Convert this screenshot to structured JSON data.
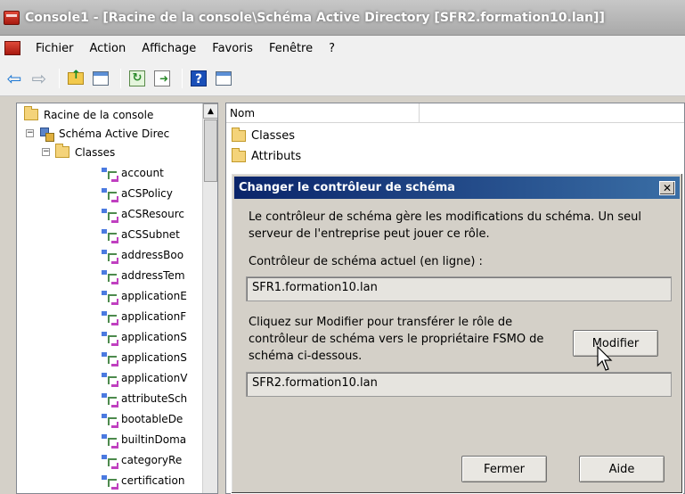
{
  "window": {
    "title": "Console1 - [Racine de la console\\Schéma Active Directory [SFR2.formation10.lan]]"
  },
  "menu": {
    "items": [
      "Fichier",
      "Action",
      "Affichage",
      "Favoris",
      "Fenêtre",
      "?"
    ]
  },
  "toolbar": {
    "icons": [
      "back-arrow-icon",
      "forward-arrow-icon",
      "up-folder-icon",
      "show-hide-tree-icon",
      "refresh-icon",
      "export-list-icon",
      "help-icon",
      "properties-icon"
    ]
  },
  "tree": {
    "root": "Racine de la console",
    "schema": "Schéma Active Direc",
    "classes_folder": "Classes",
    "classes": [
      "account",
      "aCSPolicy",
      "aCSResourc",
      "aCSSubnet",
      "addressBoo",
      "addressTem",
      "applicationE",
      "applicationF",
      "applicationS",
      "applicationS",
      "applicationV",
      "attributeSch",
      "bootableDe",
      "builtinDoma",
      "categoryRe",
      "certification"
    ]
  },
  "list": {
    "column_name": "Nom",
    "items": [
      "Classes",
      "Attributs"
    ]
  },
  "dialog": {
    "title": "Changer le contrôleur de schéma",
    "description_line1": "Le contrôleur de schéma gère les modifications du schéma. Un seul",
    "description_line2": "serveur de l'entreprise peut jouer ce rôle.",
    "current_label": "Contrôleur de schéma actuel (en ligne) :",
    "current_value": "SFR1.formation10.lan",
    "instruction_line1": "Cliquez sur Modifier pour transférer le rôle de",
    "instruction_line2": "contrôleur de schéma vers le propriétaire FSMO de",
    "instruction_line3": "schéma ci-dessous.",
    "target_value": "SFR2.formation10.lan",
    "modify_button": "Modifier",
    "close_button": "Fermer",
    "help_button": "Aide",
    "close_x": "✕"
  }
}
